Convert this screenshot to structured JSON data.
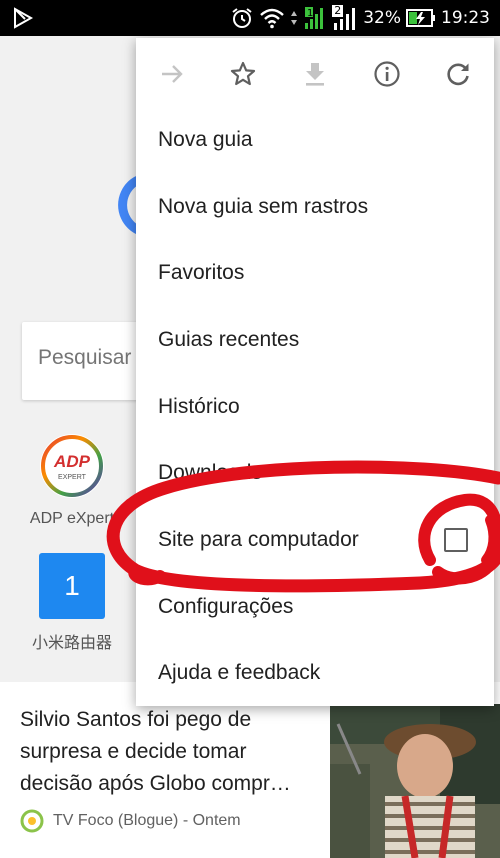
{
  "status_bar": {
    "sim2_label": "2",
    "battery": "32%",
    "time": "19:23"
  },
  "background": {
    "search_placeholder": "Pesquisar",
    "tiles": [
      {
        "label": "ADP eXpert",
        "logo_text": "ADP",
        "logo_subtext": "EXPERT"
      },
      {
        "label": "小米路由器",
        "badge": "1"
      }
    ],
    "article": {
      "title": "Silvio Santos foi pego de surpresa e decide tomar decisão após Globo compr…",
      "source": "TV Foco (Blogue) - Ontem"
    }
  },
  "menu": {
    "toolbar": [
      {
        "name": "forward-icon",
        "enabled": false
      },
      {
        "name": "star-icon",
        "enabled": true
      },
      {
        "name": "download-icon",
        "enabled": false
      },
      {
        "name": "info-icon",
        "enabled": true
      },
      {
        "name": "reload-icon",
        "enabled": true
      }
    ],
    "items": [
      {
        "label": "Nova guia"
      },
      {
        "label": "Nova guia sem rastros"
      },
      {
        "label": "Favoritos"
      },
      {
        "label": "Guias recentes"
      },
      {
        "label": "Histórico"
      },
      {
        "label": "Downloads"
      },
      {
        "label": "Site para computador",
        "checkbox": false
      },
      {
        "label": "Configurações"
      },
      {
        "label": "Ajuda e feedback"
      }
    ]
  },
  "colors": {
    "annotation": "#e0101a",
    "icon_active": "#5f5f5f",
    "icon_disabled": "#c4c4c4",
    "tile_blue": "#1e88f0"
  }
}
